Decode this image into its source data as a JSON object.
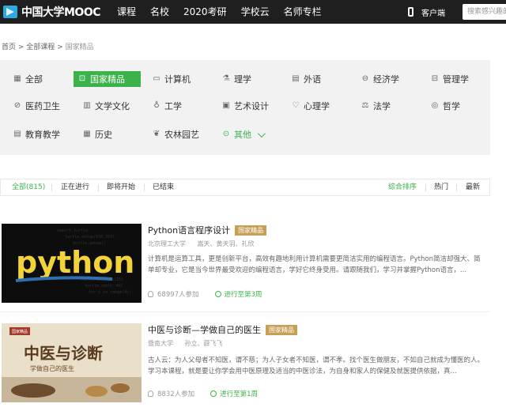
{
  "header": {
    "logo_text": "中国大学MOOC",
    "nav": [
      "课程",
      "名校",
      "2020考研",
      "学校云",
      "名师专栏"
    ],
    "client_label": "客户端",
    "search_placeholder": "搜索感兴趣的"
  },
  "breadcrumb": {
    "home": "首页",
    "sep1": " > ",
    "all": "全部课程",
    "sep2": " > ",
    "current": "国家精品"
  },
  "categories": [
    {
      "label": "全部",
      "icon": "grid-icon",
      "glyph": "▦"
    },
    {
      "label": "国家精品",
      "icon": "medal-icon",
      "glyph": "⊡",
      "active": true
    },
    {
      "label": "计算机",
      "icon": "monitor-icon",
      "glyph": "▭"
    },
    {
      "label": "理学",
      "icon": "flask-icon",
      "glyph": "⚗"
    },
    {
      "label": "外语",
      "icon": "chat-icon",
      "glyph": "▤"
    },
    {
      "label": "经济学",
      "icon": "coin-icon",
      "glyph": "⊖"
    },
    {
      "label": "管理学",
      "icon": "briefcase-icon",
      "glyph": "⊟"
    },
    {
      "label": "医药卫生",
      "icon": "pill-icon",
      "glyph": "⊘"
    },
    {
      "label": "文学文化",
      "icon": "book-icon",
      "glyph": "▥"
    },
    {
      "label": "工学",
      "icon": "bulb-icon",
      "glyph": "♁"
    },
    {
      "label": "艺术设计",
      "icon": "palette-icon",
      "glyph": "▣"
    },
    {
      "label": "心理学",
      "icon": "heart-icon",
      "glyph": "♡"
    },
    {
      "label": "法学",
      "icon": "scales-icon",
      "glyph": "⚖"
    },
    {
      "label": "哲学",
      "icon": "location-icon",
      "glyph": "◎"
    },
    {
      "label": "教育教学",
      "icon": "document-icon",
      "glyph": "▤"
    },
    {
      "label": "历史",
      "icon": "calendar-icon",
      "glyph": "▦"
    },
    {
      "label": "农林园艺",
      "icon": "leaf-icon",
      "glyph": "❦"
    },
    {
      "label": "其他",
      "icon": "more-icon",
      "glyph": "⊙",
      "more": true
    }
  ],
  "filters": {
    "all": "全部(815)",
    "ongoing": "正在进行",
    "upcoming": "即将开始",
    "ended": "已结束",
    "sort_default": "综合排序",
    "sort_hot": "热门",
    "sort_new": "最新"
  },
  "courses": [
    {
      "title": "Python语言程序设计",
      "badge": "国家精品",
      "school": "北京理工大学",
      "teachers": "嵩天、黄天羽、礼欣",
      "desc": "计算机是运算工具，更是创新平台，高效有趣地利用计算机需要更简洁实用的编程语言。Python简洁却强大、简单却专业，它是当今世界最受欢迎的编程语言，学好它终身受用。请跟随我们，学习并掌握Python语言，...",
      "participants": "68997人参加",
      "progress": "进行至第3周",
      "thumb_text": "python"
    },
    {
      "title": "中医与诊断—学做自己的医生",
      "badge": "国家精品",
      "school": "暨南大学",
      "teachers": "孙立、薛飞飞",
      "desc": "古人云：为人父母者不知医，谓不慈；为人子女者不知医，谓不孝。找个医生做朋友，不如自己就成为懂医的人。学习本课程，就是要让你学会用中医原理及适当的中医诊法，为自身和家人的保健及就医提供依据，真...",
      "participants": "8832人参加",
      "progress": "进行至第1周",
      "thumb_title": "中医与诊断",
      "thumb_sub": "学做自己的医生",
      "thumb_tag": "国家精品"
    }
  ]
}
